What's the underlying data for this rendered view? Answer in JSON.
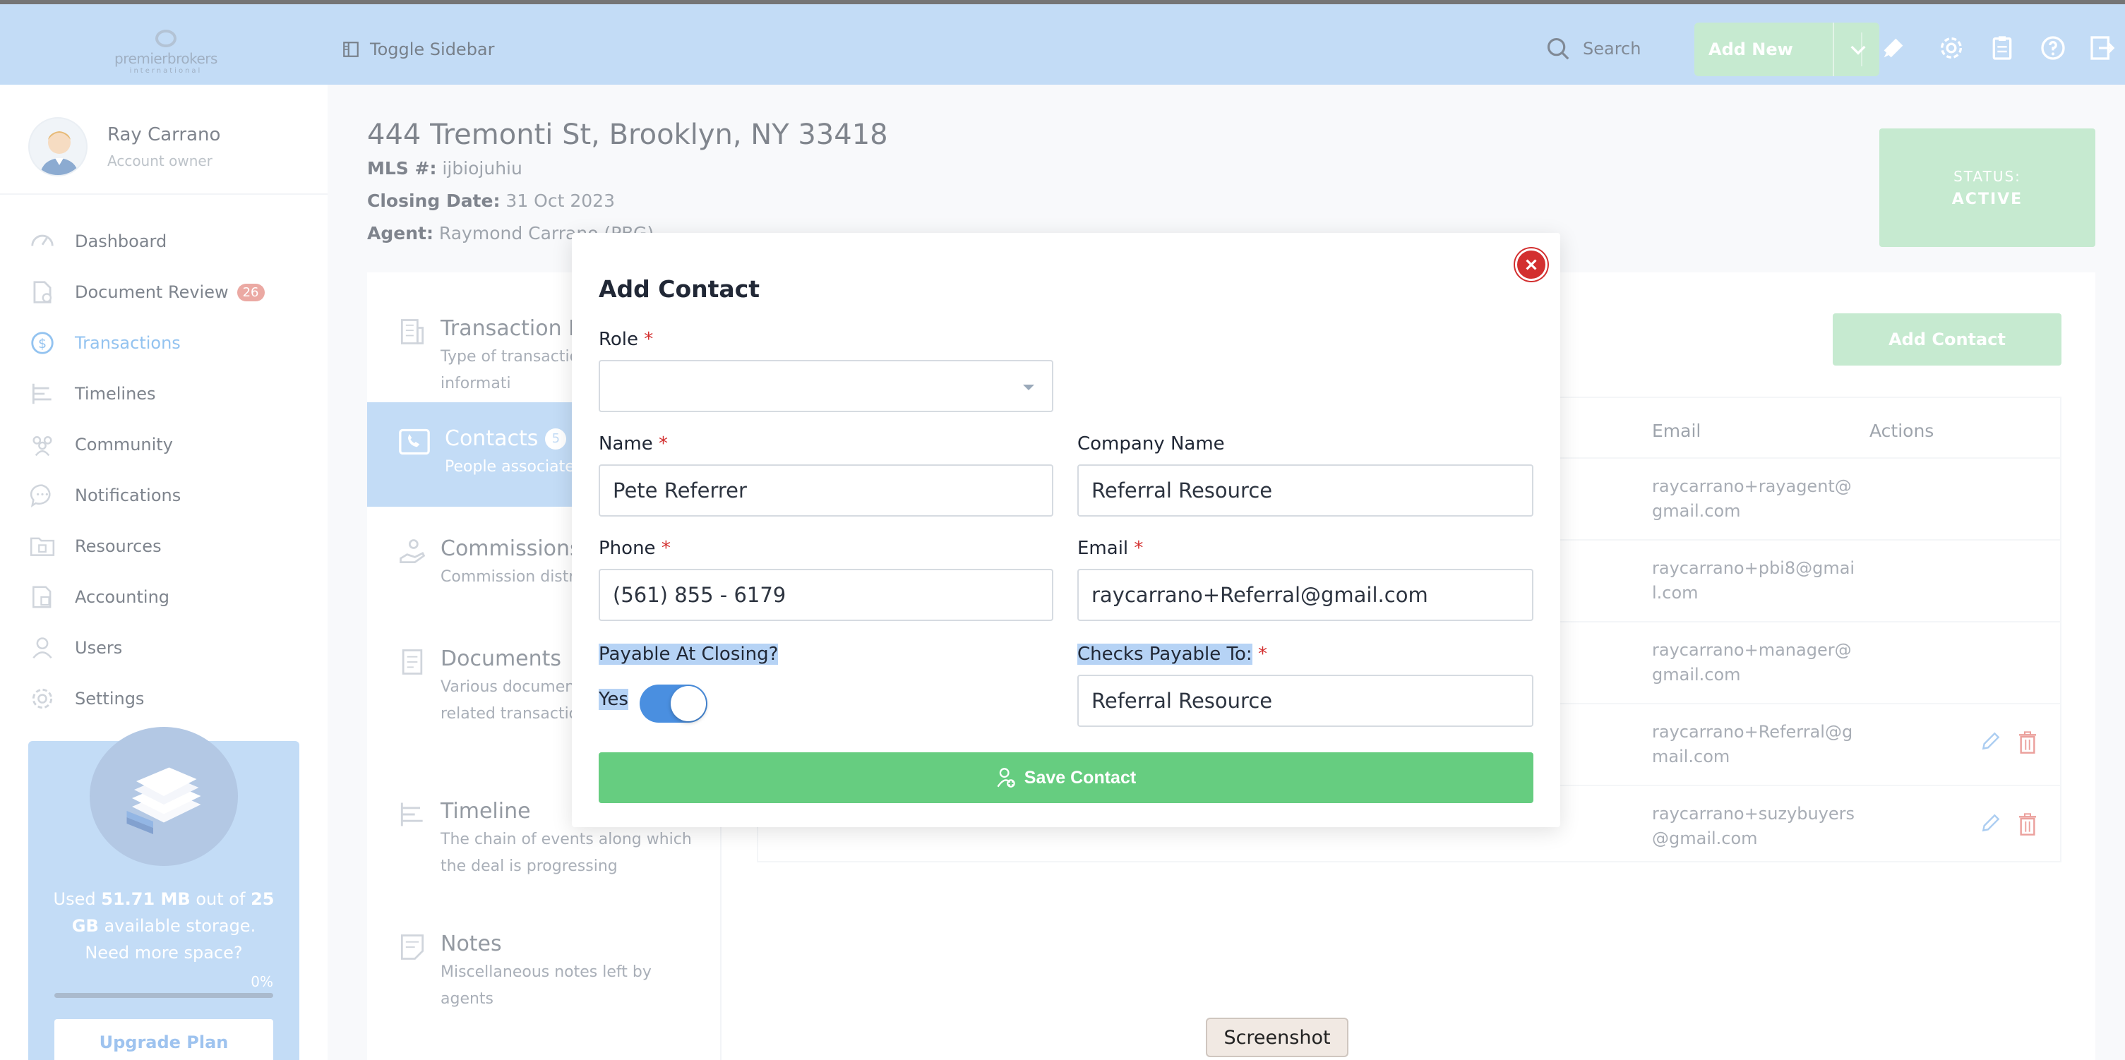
{
  "app": {
    "logo_text": "premierbrokers",
    "logo_sub": "international"
  },
  "topbar": {
    "toggle_sidebar": "Toggle Sidebar",
    "search": "Search",
    "add_new": "Add New"
  },
  "user": {
    "name": "Ray Carrano",
    "role": "Account owner"
  },
  "nav": {
    "items": [
      {
        "label": "Dashboard",
        "icon": "speedometer-icon"
      },
      {
        "label": "Document Review",
        "icon": "document-check-icon",
        "badge": "26"
      },
      {
        "label": "Transactions",
        "icon": "dollar-circle-icon",
        "active": true
      },
      {
        "label": "Timelines",
        "icon": "timeline-icon"
      },
      {
        "label": "Community",
        "icon": "people-icon"
      },
      {
        "label": "Notifications",
        "icon": "chat-bubble-icon"
      },
      {
        "label": "Resources",
        "icon": "folder-icon"
      },
      {
        "label": "Accounting",
        "icon": "accounting-icon"
      },
      {
        "label": "Users",
        "icon": "user-icon"
      },
      {
        "label": "Settings",
        "icon": "gear-icon"
      }
    ]
  },
  "storage": {
    "used_prefix": "Used",
    "used_value": "51.71 MB",
    "out_of": "out of",
    "total_value": "25 GB",
    "available": "available storage.",
    "need_more": "Need more space?",
    "percent": "0%",
    "percent_value": 0,
    "upgrade_label": "Upgrade Plan"
  },
  "property": {
    "title": "444 Tremonti St, Brooklyn, NY 33418",
    "mls_label": "MLS #:",
    "mls_value": "ijbiojuhiu",
    "closing_label": "Closing Date:",
    "closing_value": "31 Oct 2023",
    "agent_label": "Agent:",
    "agent_value": "Raymond Carrano (PBG)"
  },
  "status": {
    "label": "STATUS:",
    "value": "ACTIVE"
  },
  "tabs": [
    {
      "title": "Transaction D",
      "desc": "Type of transactio Property informati"
    },
    {
      "title": "Contacts",
      "badge": "5",
      "desc": "People associated"
    },
    {
      "title": "Commissions",
      "desc": "Commission distri"
    },
    {
      "title": "Documents",
      "desc": "Various documen contracts related transaction"
    },
    {
      "title": "Timeline",
      "desc": "The chain of events along which the deal is progressing"
    },
    {
      "title": "Notes",
      "desc": "Miscellaneous notes left by agents"
    }
  ],
  "contacts_table": {
    "add_contact": "Add Contact",
    "col_email": "Email",
    "col_actions": "Actions",
    "rows": [
      {
        "email": "raycarrano+rayagent@gmail.com",
        "actions": false
      },
      {
        "email": "raycarrano+pbi8@gmail.com",
        "actions": false
      },
      {
        "email": "raycarrano+manager@gmail.com",
        "actions": false
      },
      {
        "email": "raycarrano+Referral@gmail.com",
        "actions": true
      },
      {
        "email": "raycarrano+suzybuyers@gmail.com",
        "actions": true
      }
    ]
  },
  "modal": {
    "title": "Add Contact",
    "role_label": "Role",
    "role_value": "",
    "name_label": "Name",
    "name_value": "Pete Referrer",
    "company_label": "Company Name",
    "company_value": "Referral Resource",
    "phone_label": "Phone",
    "phone_value": "(561) 855 - 6179",
    "email_label": "Email",
    "email_value": "raycarrano+Referral@gmail.com",
    "payable_label": "Payable At Closing?",
    "payable_state": "Yes",
    "checks_label": "Checks Payable To:",
    "checks_value": "Referral Resource",
    "save_label": "Save Contact",
    "required_mark": "*"
  },
  "screenshot_tag": "Screenshot",
  "colors": {
    "topbar": "#a3c9f1",
    "accent_green": "#66cd80",
    "accent_blue": "#4a8fe0",
    "danger": "#d32f2f"
  }
}
